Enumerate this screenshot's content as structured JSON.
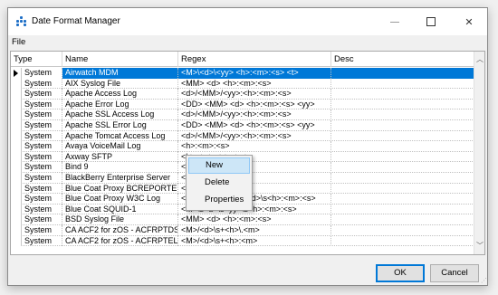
{
  "window": {
    "title": "Date Format Manager"
  },
  "menu": {
    "file": "File"
  },
  "columns": [
    "Type",
    "Name",
    "Regex",
    "Desc"
  ],
  "rows": [
    {
      "type": "System",
      "name": "Airwatch MDM",
      "regex": "<M>\\<d>\\<yy> <h>:<m>:<s> <t>",
      "desc": ""
    },
    {
      "type": "System",
      "name": "AIX Syslog File",
      "regex": "<MM> <d> <h>:<m>:<s>",
      "desc": ""
    },
    {
      "type": "System",
      "name": "Apache Access Log",
      "regex": "<d>/<MM>/<yy>:<h>:<m>:<s>",
      "desc": ""
    },
    {
      "type": "System",
      "name": "Apache Error Log",
      "regex": "<DD> <MM> <d> <h>:<m>:<s> <yy>",
      "desc": ""
    },
    {
      "type": "System",
      "name": "Apache SSL Access Log",
      "regex": "<d>/<MM>/<yy>:<h>:<m>:<s>",
      "desc": ""
    },
    {
      "type": "System",
      "name": "Apache SSL Error Log",
      "regex": "<DD> <MM> <d> <h>:<m>:<s> <yy>",
      "desc": ""
    },
    {
      "type": "System",
      "name": "Apache Tomcat Access Log",
      "regex": "<d>/<MM>/<yy>:<h>:<m>:<s>",
      "desc": ""
    },
    {
      "type": "System",
      "name": "Avaya VoiceMail Log",
      "regex": "<h>:<m>:<s>",
      "desc": ""
    },
    {
      "type": "System",
      "name": "Axway SFTP",
      "regex": "<h>:<m>:<s> <yy>",
      "desc": ""
    },
    {
      "type": "System",
      "name": "Bind 9",
      "regex": "<h>:<m>:<s>.<f>",
      "desc": ""
    },
    {
      "type": "System",
      "name": "BlackBerry Enterprise Server",
      "regex": "<s>\\.<f>",
      "desc": ""
    },
    {
      "type": "System",
      "name": "Blue Coat Proxy BCREPORTE...",
      "regex": "<s>",
      "desc": ""
    },
    {
      "type": "System",
      "name": "Blue Coat Proxy W3C Log",
      "regex": "<UTC><yy>-<M>-<d>\\s<h>:<m>:<s>",
      "desc": ""
    },
    {
      "type": "System",
      "name": "Blue Coat SQUID-1",
      "regex": "<M>\\s<d>\\s<yy>\\s<h>:<m>:<s>",
      "desc": ""
    },
    {
      "type": "System",
      "name": "BSD Syslog File",
      "regex": "<MM> <d> <h>:<m>:<s>",
      "desc": ""
    },
    {
      "type": "System",
      "name": "CA ACF2 for zOS - ACFRPTDS",
      "regex": "<M>/<d>\\s+<h>\\.<m>",
      "desc": ""
    },
    {
      "type": "System",
      "name": "CA ACF2 for zOS - ACFRPTEL",
      "regex": "<M>/<d>\\s+<h>:<m>",
      "desc": ""
    }
  ],
  "context_menu": {
    "items": [
      "New",
      "Delete",
      "Properties"
    ]
  },
  "buttons": {
    "ok": "OK",
    "cancel": "Cancel"
  },
  "colors": {
    "selection": "#0078d7",
    "menu_highlight": "#cde6f7",
    "icon": "#1e6fc7"
  }
}
